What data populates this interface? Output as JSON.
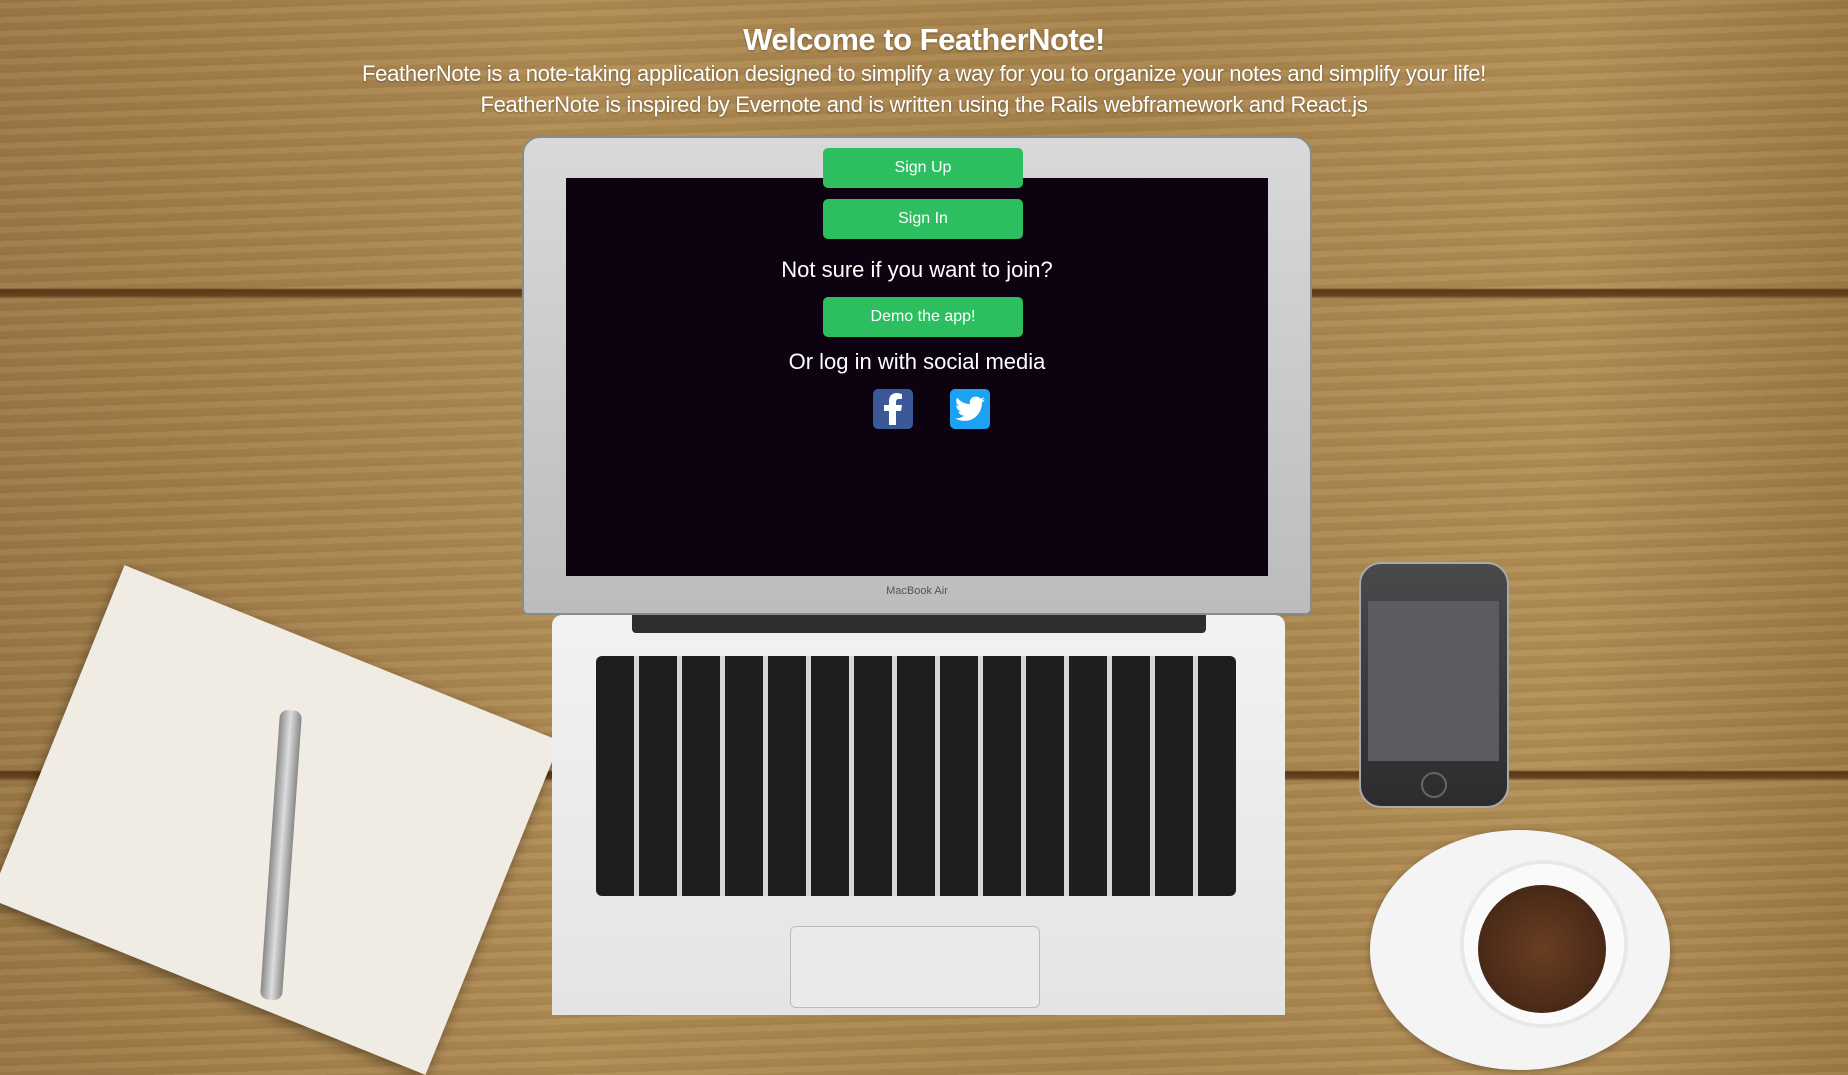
{
  "header": {
    "title": "Welcome to FeatherNote!",
    "subtitle_line1": "FeatherNote is a note-taking application designed to simplify a way for you to organize your notes and simplify your life!",
    "subtitle_line2": "FeatherNote is inspired by Evernote and is written using the Rails webframework and React.js"
  },
  "auth": {
    "sign_up_label": "Sign Up",
    "sign_in_label": "Sign In",
    "join_prompt": "Not sure if you want to join?",
    "demo_label": "Demo the app!",
    "social_prompt": "Or log in with social media",
    "social": [
      {
        "icon": "facebook-icon",
        "color": "#3b5998"
      },
      {
        "icon": "twitter-icon",
        "color": "#1da1f2"
      }
    ]
  },
  "background": {
    "laptop_brand": "MacBook Air"
  },
  "colors": {
    "accent": "#2dbe60",
    "screen": "#0c0210"
  }
}
